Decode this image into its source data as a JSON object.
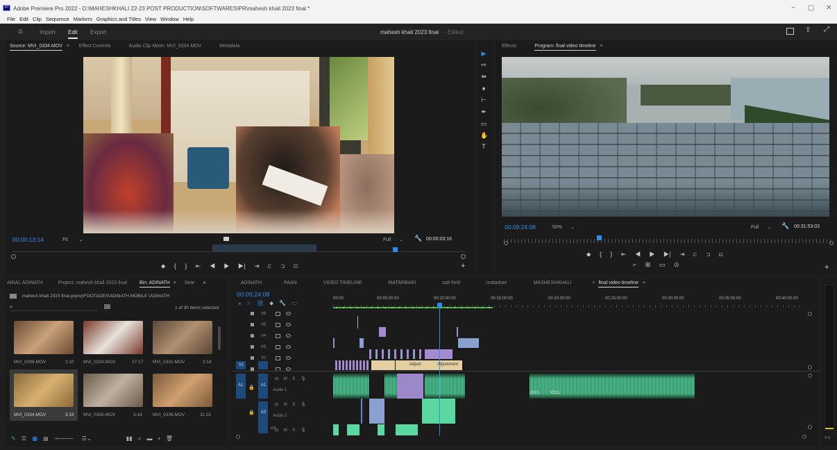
{
  "window": {
    "title": "Adobe Premiere Pro 2022 - D:\\MAHESHKHALI 22-23 POST PRODUCTION\\SOFTWARES\\PR\\mahesh khali 2023 final *",
    "logo": "Pr",
    "min": "−",
    "max": "▢",
    "close": "✕"
  },
  "menu": [
    "File",
    "Edit",
    "Clip",
    "Sequence",
    "Markers",
    "Graphics and Titles",
    "View",
    "Window",
    "Help"
  ],
  "appbar": {
    "tabs": [
      "Import",
      "Edit",
      "Export"
    ],
    "active": "Edit",
    "project": "mahesh khali 2023 final",
    "status": "- Edited"
  },
  "source": {
    "tabs": [
      "Source: MVI_0334.MOV",
      "Effect Controls",
      "Audio Clip Mixer: MVI_0334.MOV",
      "Metadata"
    ],
    "timecode": "00:00:13:14",
    "zoom": "Fit",
    "quality": "Full",
    "duration": "00:00:03:16"
  },
  "program": {
    "tabs": [
      "Effects",
      "Program: final video timeline"
    ],
    "timecode": "00:09:24:08",
    "zoom": "50%",
    "quality": "Full",
    "duration": "00:31:53:03"
  },
  "project": {
    "tabs": [
      "ARIAL ADINATH",
      "Project: mahesh khali 2023 final",
      "Bin: ADINATH",
      "Sear"
    ],
    "path": "mahesh khali 2023 final.prproj\\FOOTAGES\\ADINATH MOBILE \\ADINATH",
    "count": "1 of 30 items selected",
    "items": [
      {
        "name": "MVI_0296.MOV",
        "dur": "2:10",
        "c1": "#6b4a32",
        "c2": "#c9a27a"
      },
      {
        "name": "MVI_0324.MOV",
        "dur": "17:17",
        "c1": "#7a3a2a",
        "c2": "#e8e2dc"
      },
      {
        "name": "MVI_0331.MOV",
        "dur": "2:14",
        "c1": "#5a4636",
        "c2": "#b09070"
      },
      {
        "name": "MVI_0334.MOV",
        "dur": "3:16",
        "c1": "#8a6a3a",
        "c2": "#d8b070"
      },
      {
        "name": "MVI_0335.MOV",
        "dur": "3:14",
        "c1": "#6a5a4a",
        "c2": "#c0b0a0"
      },
      {
        "name": "MVI_0336.MOV",
        "dur": "11:23",
        "c1": "#7a5a3a",
        "c2": "#d0a070"
      }
    ]
  },
  "timeline": {
    "tabs": [
      "ADINATH",
      "PAAN",
      "VIDEO TIMELINE",
      "MATARBARI",
      "salt field",
      "matarbari",
      "MASHESHKHALI",
      "final video timeline"
    ],
    "active": "final video timeline",
    "timecode": "00:09:24:08",
    "ruler": [
      "00:00",
      "00:05:00:00",
      "00:10:00:00",
      "00:15:00:00",
      "00:20:00:00",
      "00:25:00:00",
      "00:30:00:00",
      "00:35:00:00",
      "00:40:00:00"
    ],
    "vtracks": [
      "V6",
      "V5",
      "V4",
      "V3",
      "V2",
      "V1"
    ],
    "atracks": [
      "A1",
      "A2",
      "A3"
    ],
    "audio1": "Audio 1",
    "audio2": "Audio 2",
    "adjust1": "Adjust",
    "adjust2": "Adjustment",
    "ch": "Ch:1"
  },
  "bottom": {
    "meter": "S S"
  }
}
